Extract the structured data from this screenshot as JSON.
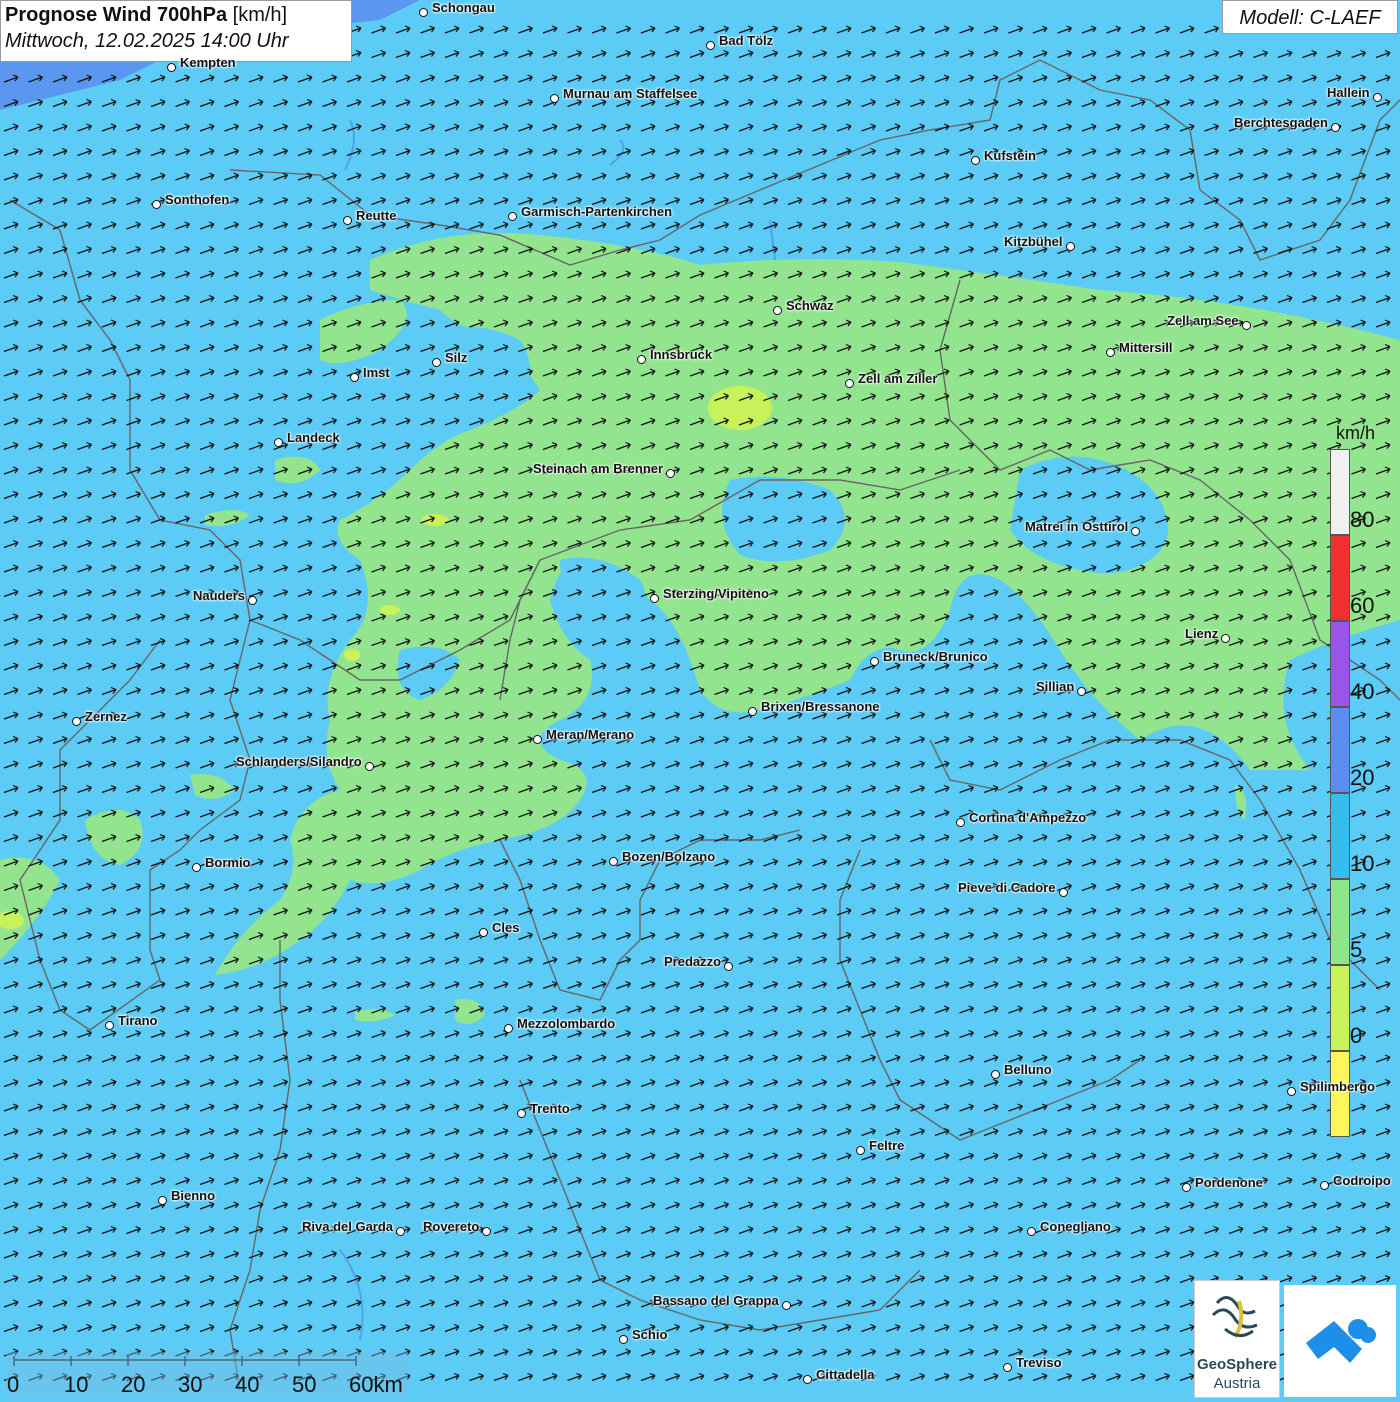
{
  "header": {
    "title_bold": "Prognose Wind 700hPa",
    "title_unit": "[km/h]",
    "datetime": "Mittwoch, 12.02.2025 14:00 Uhr",
    "model": "Modell: C-LAEF"
  },
  "legend": {
    "unit": "km/h",
    "stops": [
      {
        "label": "80",
        "color": "#f03030"
      },
      {
        "label": "60",
        "color": "#9a55e8"
      },
      {
        "label": "40",
        "color": "#5b8ef0"
      },
      {
        "label": "20",
        "color": "#35bdf0"
      },
      {
        "label": "10",
        "color": "#8fe58a"
      },
      {
        "label": "5",
        "color": "#c8f25a"
      },
      {
        "label": "0",
        "color": "#fdf55a"
      }
    ],
    "top_color": "#f0f0f0"
  },
  "scalebar": {
    "labels": [
      "0",
      "10",
      "20",
      "30",
      "40",
      "50",
      "60km"
    ]
  },
  "logos": {
    "geosphere_line1": "GeoSphere",
    "geosphere_line2": "Austria"
  },
  "colors": {
    "base_wind": "#5ccbf5",
    "light_wind": "#92e58e",
    "arrow": "#111111"
  },
  "cities": [
    {
      "name": "Schongau"
    },
    {
      "name": "Bad Tölz"
    },
    {
      "name": "Kempten"
    },
    {
      "name": "Murnau am Staffelsee"
    },
    {
      "name": "Hallein"
    },
    {
      "name": "Berchtesgaden"
    },
    {
      "name": "Kufstein"
    },
    {
      "name": "Sonthofen"
    },
    {
      "name": "Reutte"
    },
    {
      "name": "Garmisch-Partenkirchen"
    },
    {
      "name": "Kitzbühel"
    },
    {
      "name": "Schwaz"
    },
    {
      "name": "Zell am See"
    },
    {
      "name": "Innsbruck"
    },
    {
      "name": "Mittersill"
    },
    {
      "name": "Silz"
    },
    {
      "name": "Imst"
    },
    {
      "name": "Zell am Ziller"
    },
    {
      "name": "Landeck"
    },
    {
      "name": "Steinach am Brenner"
    },
    {
      "name": "Matrei in Osttirol"
    },
    {
      "name": "Nauders"
    },
    {
      "name": "Sterzing/Vipiteno"
    },
    {
      "name": "Lienz"
    },
    {
      "name": "Bruneck/Brunico"
    },
    {
      "name": "Sillian"
    },
    {
      "name": "Brixen/Bressanone"
    },
    {
      "name": "Zernez"
    },
    {
      "name": "Meran/Merano"
    },
    {
      "name": "Schlanders/Silandro"
    },
    {
      "name": "Cortina d'Ampezzo"
    },
    {
      "name": "Bozen/Bolzano"
    },
    {
      "name": "Bormio"
    },
    {
      "name": "Pieve di Cadore"
    },
    {
      "name": "Cles"
    },
    {
      "name": "Predazzo"
    },
    {
      "name": "Tirano"
    },
    {
      "name": "Mezzolombardo"
    },
    {
      "name": "Belluno"
    },
    {
      "name": "Spilimbergo"
    },
    {
      "name": "Trento"
    },
    {
      "name": "Feltre"
    },
    {
      "name": "Pordenone"
    },
    {
      "name": "Codroipo"
    },
    {
      "name": "Bienno"
    },
    {
      "name": "Riva del Garda"
    },
    {
      "name": "Rovereto"
    },
    {
      "name": "Conegliano"
    },
    {
      "name": "Bassano del Grappa"
    },
    {
      "name": "Schio"
    },
    {
      "name": "Treviso"
    },
    {
      "name": "Cittadella"
    }
  ]
}
